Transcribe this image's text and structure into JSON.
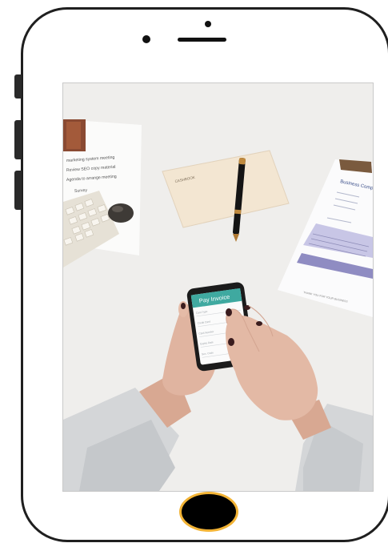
{
  "device": {
    "frame_color": "#1f1f1f",
    "home_button_ring_color": "#f2b335"
  },
  "screen": {
    "image": {
      "phone_screen": {
        "header_text": "Pay Invoice",
        "fields": [
          "Card Type",
          "Credit Card",
          "Card Number",
          "Expiry Date",
          "Sec. Code"
        ],
        "header_color": "#3fa9a0"
      },
      "invoice_paper": {
        "title": "Business Comp",
        "footer": "THANK YOU FOR YOUR BUSINESS"
      },
      "notebook": {
        "lines": [
          "marketing system meeting",
          "Review SEO copy material",
          "Agenda to arrange meeting",
          "Survey"
        ]
      },
      "envelope_label": "CASHBOOK"
    }
  }
}
